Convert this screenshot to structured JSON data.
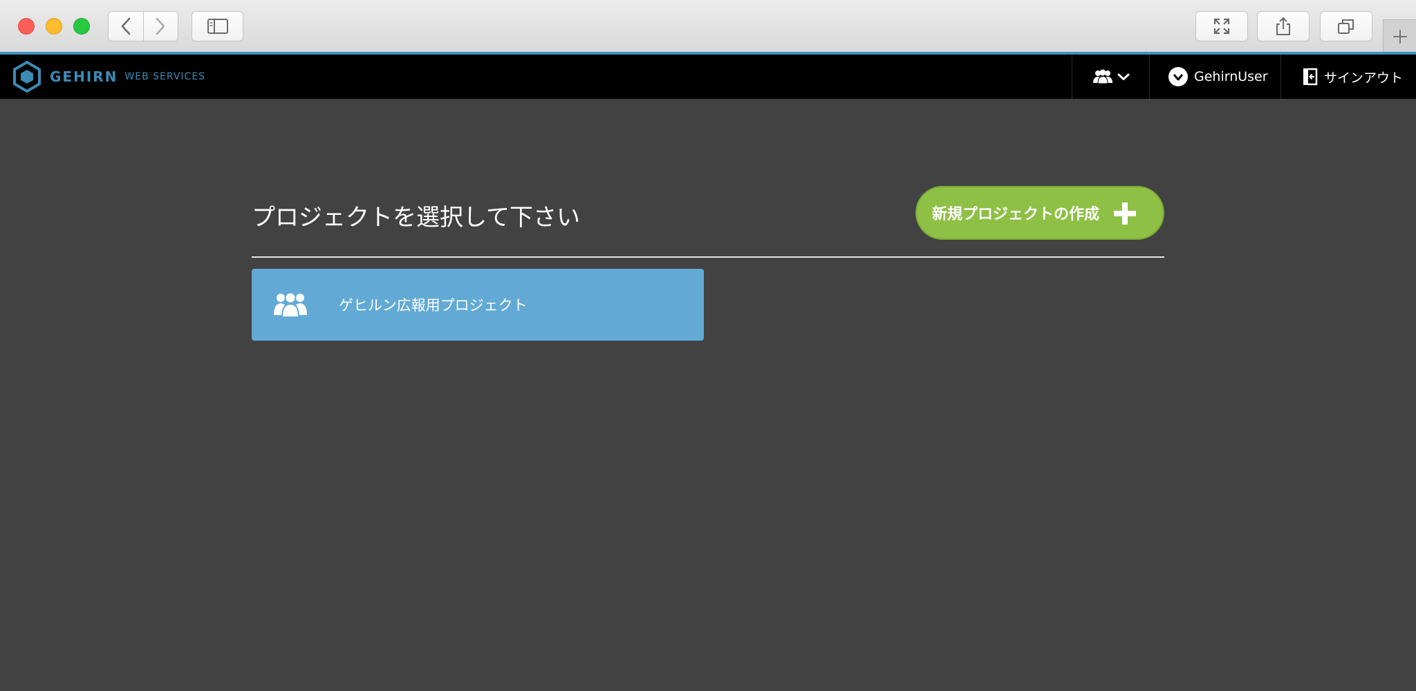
{
  "browser": {
    "icons": {
      "close": "close-dot",
      "minimize": "minimize-dot",
      "zoom": "zoom-dot",
      "back": "chevron-left-icon",
      "forward": "chevron-right-icon",
      "sidebar": "sidebar-icon",
      "fullscreen": "fullscreen-icon",
      "share": "share-icon",
      "tabs": "tabs-icon",
      "new_tab": "plus-icon"
    }
  },
  "header": {
    "logo_brand": "GEHIRN",
    "logo_sub": "WEB SERVICES",
    "user_name": "GehirnUser",
    "signout_label": "サインアウト"
  },
  "main": {
    "title": "プロジェクトを選択して下さい",
    "create_button_label": "新規プロジェクトの作成",
    "projects": [
      {
        "name": "ゲヒルン広報用プロジェクト"
      }
    ]
  },
  "colors": {
    "accent": "#3c8bb4",
    "create_button": "#8dc044",
    "project_card": "#62aad5",
    "background": "#424242",
    "navbar": "#000000"
  }
}
